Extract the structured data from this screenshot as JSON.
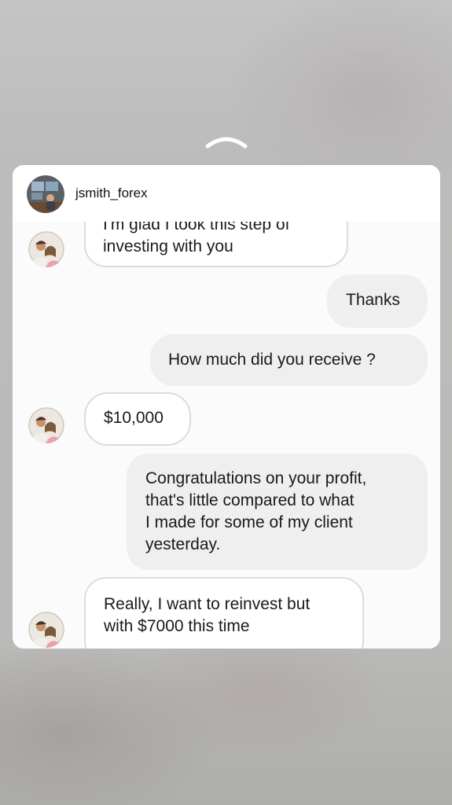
{
  "story": {
    "username": "jsmith_forex",
    "swipe_icon": "chevron-up-icon"
  },
  "conversation": {
    "messages": [
      {
        "side": "in",
        "text": "I'm glad I took this step of\ninvesting with you"
      },
      {
        "side": "out",
        "text": "Thanks"
      },
      {
        "side": "out",
        "text": "How much did you receive ?"
      },
      {
        "side": "in",
        "text": "$10,000"
      },
      {
        "side": "out",
        "text": "Congratulations on your profit,\nthat's little compared to what\nI made for some of my client\nyesterday."
      },
      {
        "side": "in",
        "text": "Really, I want to reinvest but\nwith $7000 this time"
      }
    ]
  },
  "colors": {
    "card": "#ffffff",
    "incoming_bubble": "#ffffff",
    "outgoing_bubble": "#efefef",
    "bubble_border": "#dcdcdc",
    "text": "#1a1a1a"
  }
}
